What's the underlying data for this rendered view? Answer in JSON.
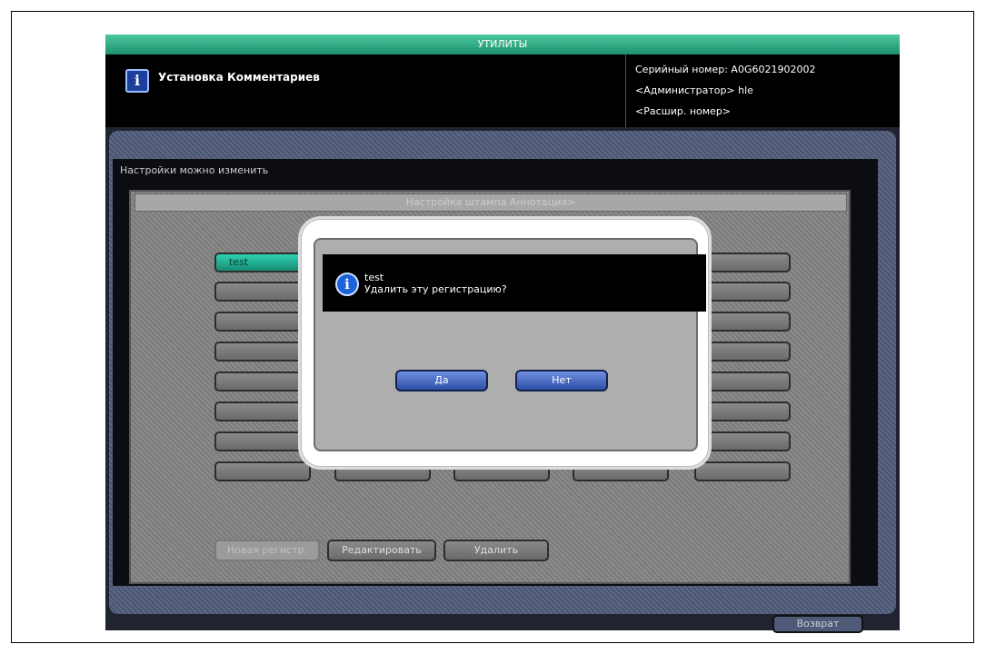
{
  "titlebar": {
    "text": "УТИЛИТЫ"
  },
  "header": {
    "title": "Установка Комментариев",
    "serial": "Серийный номер:  A0G6021902002",
    "admin": "<Администратор>    hle",
    "ext": "<Расшир. номер>"
  },
  "section": {
    "label": "Настройки можно изменить"
  },
  "stamp": {
    "title": "Настройка штампа Аннотация>"
  },
  "grid": {
    "selected_label": "test"
  },
  "bottom": {
    "new_label": "Новая регистр.",
    "edit_label": "Редактировать",
    "delete_label": "Удалить"
  },
  "footer": {
    "back_label": "Возврат"
  },
  "dialog": {
    "line1": "test",
    "line2": "Удалить эту регистрацию?",
    "yes_label": "Да",
    "no_label": "Нет"
  },
  "icons": {
    "header_icon": "info-icon",
    "dialog_icon": "info-circle-icon"
  },
  "colors": {
    "accent": "#1b8f6c",
    "dialog_button": "#2d4fa6",
    "selected": "#2ed2b3"
  }
}
